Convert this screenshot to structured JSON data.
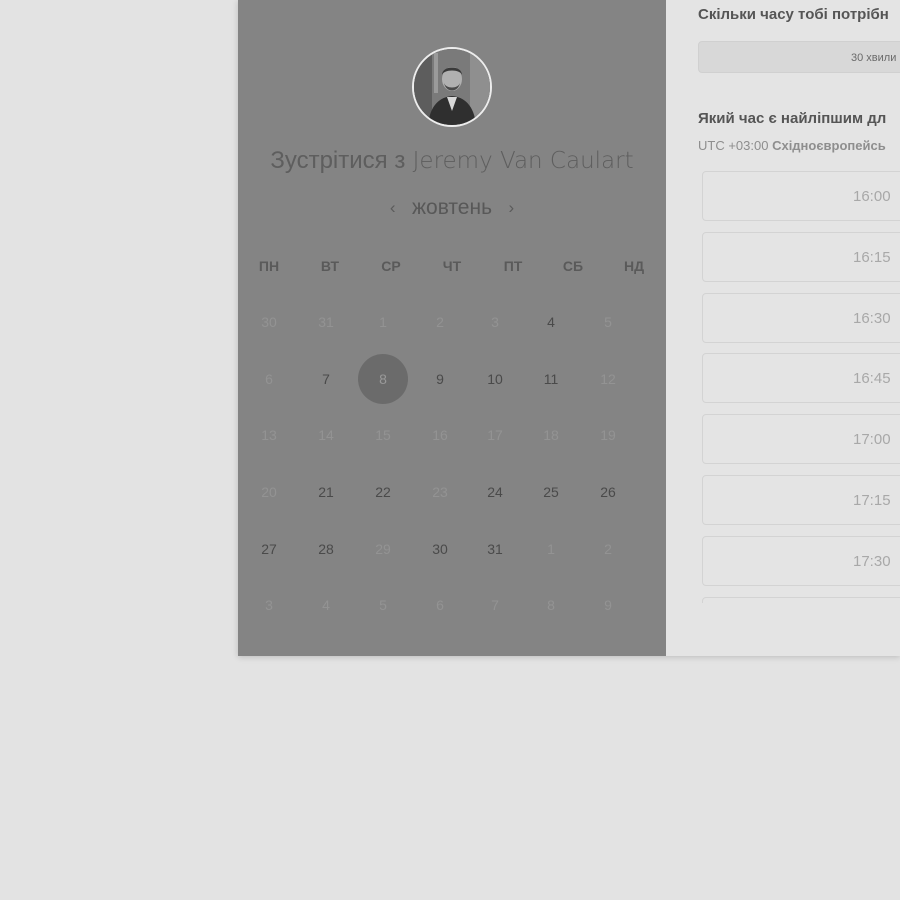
{
  "host": {
    "avatar": "host-portrait-photo",
    "title_prefix": "Зустрітися з",
    "title_name": "Jeremy Van Caulart"
  },
  "calendar": {
    "month": "жовтень",
    "prev_icon": "chevron-left-icon",
    "next_icon": "chevron-right-icon",
    "weekdays": [
      "ПН",
      "ВТ",
      "СР",
      "ЧТ",
      "ПТ",
      "СБ",
      "НД"
    ],
    "weeks": [
      [
        {
          "d": "30",
          "s": "muted"
        },
        {
          "d": "31",
          "s": "muted"
        },
        {
          "d": "1",
          "s": "muted"
        },
        {
          "d": "2",
          "s": "muted"
        },
        {
          "d": "3",
          "s": "muted"
        },
        {
          "d": "4",
          "s": "avail"
        },
        {
          "d": "5",
          "s": "muted"
        }
      ],
      [
        {
          "d": "6",
          "s": "muted"
        },
        {
          "d": "7",
          "s": "avail"
        },
        {
          "d": "8",
          "s": "selected"
        },
        {
          "d": "9",
          "s": "avail"
        },
        {
          "d": "10",
          "s": "avail"
        },
        {
          "d": "11",
          "s": "avail"
        },
        {
          "d": "12",
          "s": "muted"
        }
      ],
      [
        {
          "d": "13",
          "s": "muted"
        },
        {
          "d": "14",
          "s": "muted"
        },
        {
          "d": "15",
          "s": "muted"
        },
        {
          "d": "16",
          "s": "muted"
        },
        {
          "d": "17",
          "s": "muted"
        },
        {
          "d": "18",
          "s": "muted"
        },
        {
          "d": "19",
          "s": "muted"
        }
      ],
      [
        {
          "d": "20",
          "s": "muted"
        },
        {
          "d": "21",
          "s": "avail"
        },
        {
          "d": "22",
          "s": "avail"
        },
        {
          "d": "23",
          "s": "muted"
        },
        {
          "d": "24",
          "s": "avail"
        },
        {
          "d": "25",
          "s": "avail"
        },
        {
          "d": "26",
          "s": "avail"
        }
      ],
      [
        {
          "d": "27",
          "s": "avail"
        },
        {
          "d": "28",
          "s": "avail"
        },
        {
          "d": "29",
          "s": "muted"
        },
        {
          "d": "30",
          "s": "avail"
        },
        {
          "d": "31",
          "s": "avail"
        },
        {
          "d": "1",
          "s": "muted"
        },
        {
          "d": "2",
          "s": "muted"
        }
      ],
      [
        {
          "d": "3",
          "s": "muted"
        },
        {
          "d": "4",
          "s": "muted"
        },
        {
          "d": "5",
          "s": "muted"
        },
        {
          "d": "6",
          "s": "muted"
        },
        {
          "d": "7",
          "s": "muted"
        },
        {
          "d": "8",
          "s": "muted"
        },
        {
          "d": "9",
          "s": "muted"
        }
      ]
    ]
  },
  "booking": {
    "duration_question": "Скільки часу тобі потрібн",
    "duration_value": "30 хвили",
    "time_question": "Який час є найліпшим дл",
    "timezone_offset": "UTC +03:00",
    "timezone_name": "Східноєвропейсь",
    "slots": [
      "16:00",
      "16:15",
      "16:30",
      "16:45",
      "17:00",
      "17:15",
      "17:30",
      ""
    ]
  },
  "colors": {
    "page_background": "#e3e3e3",
    "left_panel": "#848484",
    "right_panel": "#e4e4e4",
    "selected_day": "#6b6b6b"
  }
}
